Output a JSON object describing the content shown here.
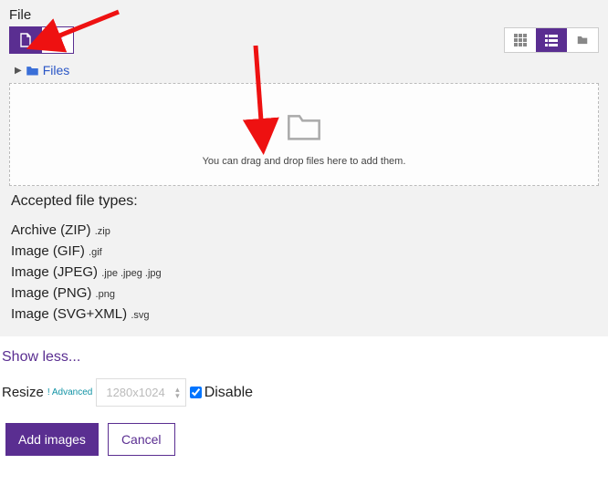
{
  "header": {
    "file_label": "File"
  },
  "tree": {
    "files_label": "Files"
  },
  "dropzone": {
    "hint": "You can drag and drop files here to add them."
  },
  "accepted": {
    "heading": "Accepted file types:",
    "types": [
      {
        "label": "Archive (ZIP)",
        "ext": ".zip"
      },
      {
        "label": "Image (GIF)",
        "ext": ".gif"
      },
      {
        "label": "Image (JPEG)",
        "ext": ".jpe .jpeg .jpg"
      },
      {
        "label": "Image (PNG)",
        "ext": ".png"
      },
      {
        "label": "Image (SVG+XML)",
        "ext": ".svg"
      }
    ]
  },
  "toggle": {
    "show_less": "Show less..."
  },
  "resize": {
    "label": "Resize",
    "advanced": "! Advanced",
    "size_value": "1280x1024",
    "disable_label": "Disable",
    "disable_checked": true
  },
  "actions": {
    "add_images": "Add images",
    "cancel": "Cancel"
  },
  "colors": {
    "accent": "#5a2e91",
    "link": "#2a56c6",
    "teal": "#1193a5",
    "annotation": "#e11"
  }
}
